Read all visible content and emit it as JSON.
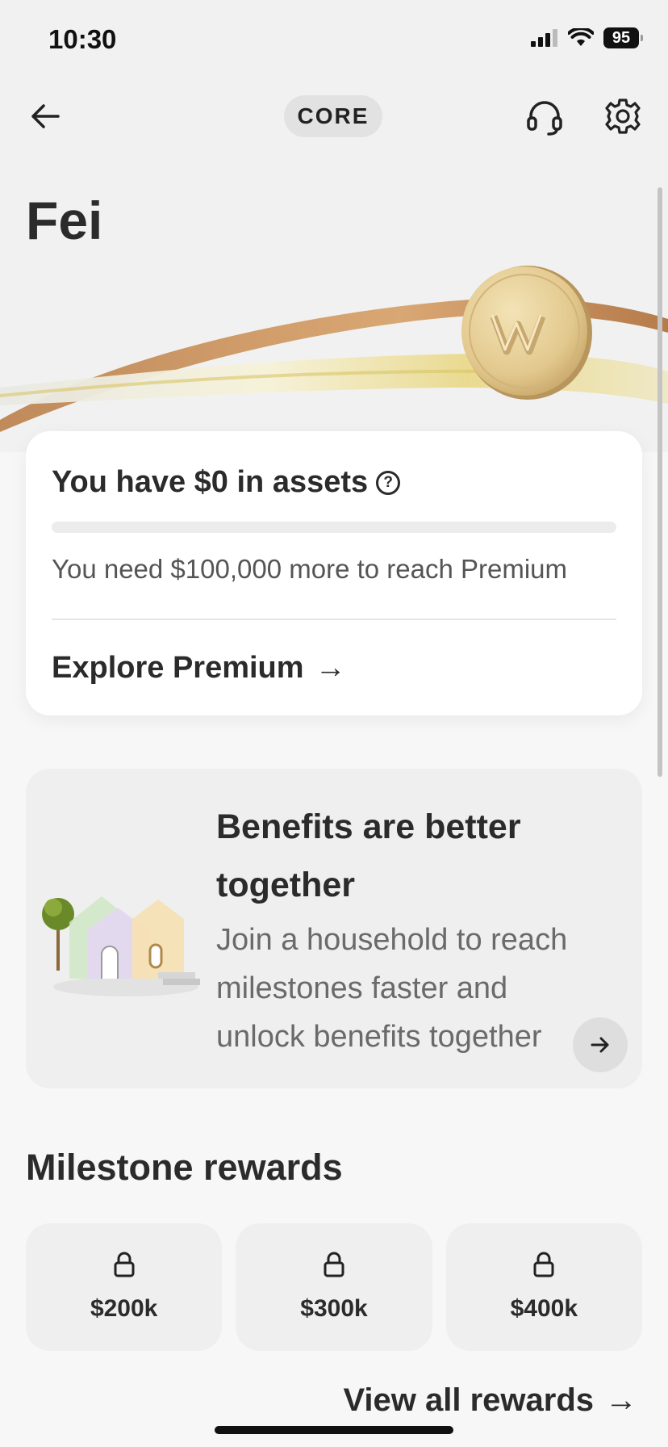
{
  "status_bar": {
    "time": "10:30",
    "battery": "95",
    "icons": [
      "cellular-signal-icon",
      "wifi-icon",
      "battery-icon"
    ]
  },
  "nav": {
    "tier_label": "CORE",
    "icons": [
      "back-arrow-icon",
      "headset-icon",
      "gear-icon"
    ]
  },
  "profile": {
    "name": "Fei"
  },
  "assets": {
    "title": "You have $0 in assets",
    "help_glyph": "?",
    "progress": 0,
    "subtitle": "You need $100,000 more to reach Premium",
    "explore_label": "Explore Premium",
    "explore_arrow": "→"
  },
  "benefits": {
    "title": "Benefits are better together",
    "body": "Join a household to reach milestones faster and unlock benefits together",
    "arrow": "→"
  },
  "milestones": {
    "heading": "Milestone rewards",
    "items": [
      {
        "value": "$200k",
        "locked": true
      },
      {
        "value": "$300k",
        "locked": true
      },
      {
        "value": "$400k",
        "locked": true
      }
    ],
    "view_all_label": "View all rewards",
    "view_all_arrow": "→"
  },
  "colors": {
    "background": "#f7f7f7",
    "card": "#ffffff",
    "tile": "#efefef",
    "text": "#2b2b2b",
    "muted": "#6a6a6a",
    "gold": "#c9a86a"
  }
}
